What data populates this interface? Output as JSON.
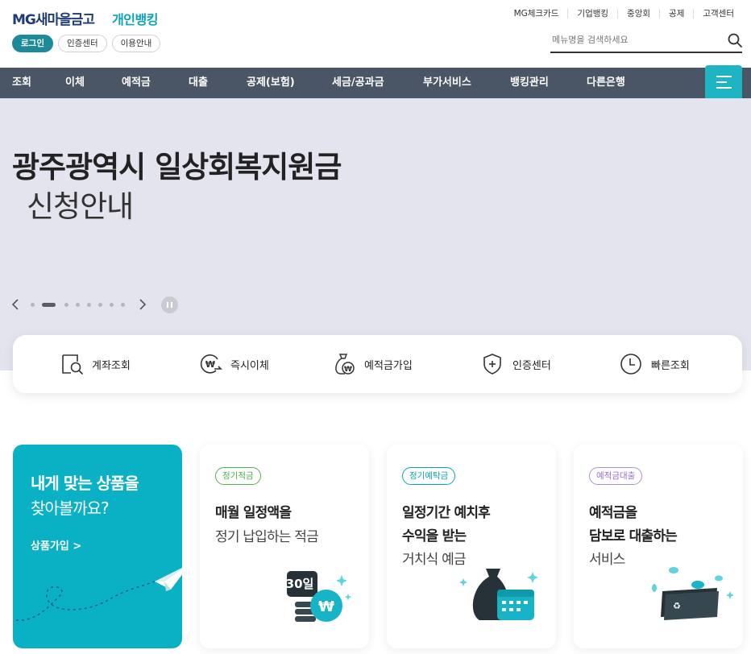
{
  "header": {
    "logo_main": "MG새마을금고",
    "logo_sub": "개인뱅킹",
    "util_links": [
      "MG체크카드",
      "기업뱅킹",
      "중앙회",
      "공제",
      "고객센터"
    ],
    "pills": [
      "로그인",
      "인증센터",
      "이용안내"
    ],
    "search_placeholder": "메뉴명을 검색하세요"
  },
  "gnb": {
    "items": [
      "조회",
      "이체",
      "예적금",
      "대출",
      "공제(보험)",
      "세금/공과금",
      "부가서비스",
      "뱅킹관리",
      "다른은행"
    ],
    "menu_icon": "hamburger-icon"
  },
  "hero": {
    "title": "광주광역시 일상회복지원금",
    "subtitle": "신청안내",
    "slide_count": 8,
    "active_slide": 2
  },
  "quick_menu": [
    {
      "label": "계좌조회",
      "icon": "account-search-icon"
    },
    {
      "label": "즉시이체",
      "icon": "transfer-icon"
    },
    {
      "label": "예적금가입",
      "icon": "savings-bag-icon"
    },
    {
      "label": "인증센터",
      "icon": "shield-icon"
    },
    {
      "label": "빠른조회",
      "icon": "clock-icon"
    }
  ],
  "promo": {
    "line1": "내게 맞는 상품을",
    "line2": "찾아볼까요?",
    "link": "상품가입 >"
  },
  "cards": [
    {
      "badge": "정기적금",
      "bold": [
        "매월 일정액을"
      ],
      "light": "정기 납입하는 적금",
      "art_text": "30일",
      "badge_color": "#4caf50"
    },
    {
      "badge": "정기예탁금",
      "bold": [
        "일정기간 예치후",
        "수익을 받는"
      ],
      "light": "거치식 예금",
      "badge_color": "#0aa5b5"
    },
    {
      "badge": "예적금대출",
      "bold": [
        "예적금을",
        "담보로 대출하는"
      ],
      "light": "서비스",
      "badge_color": "#9c6bd0"
    }
  ],
  "colors": {
    "brand_navy": "#1d3c78",
    "brand_teal": "#0ab1c4",
    "gnb_bg": "#4a5566",
    "hero_bg": "#e3e4ee"
  }
}
